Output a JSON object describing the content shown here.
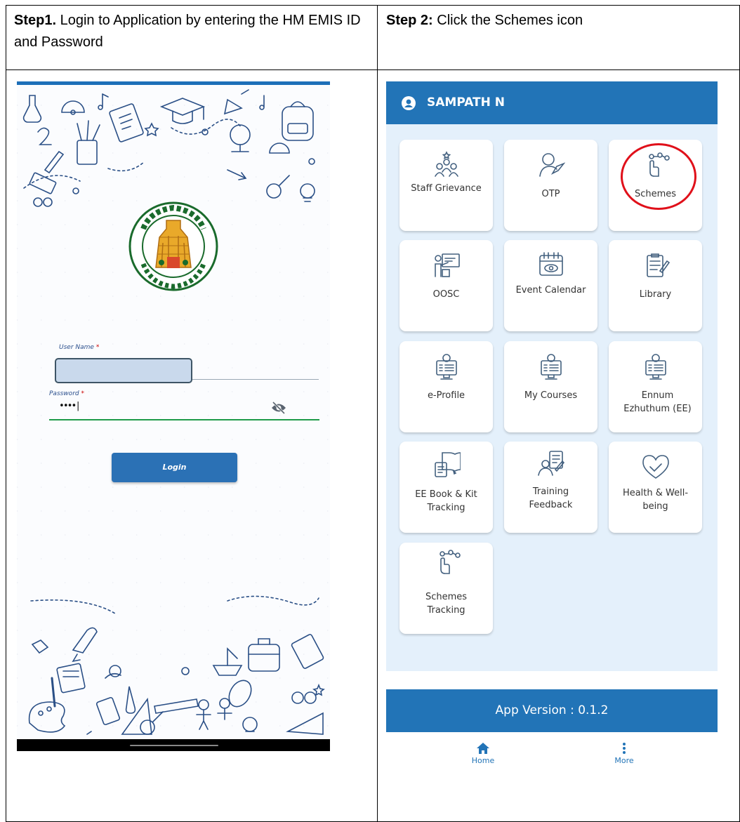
{
  "steps": {
    "step1": {
      "bold": "Step1.",
      "text": " Login to Application by entering the HM EMIS ID and Password"
    },
    "step2": {
      "bold": "Step 2:",
      "text": " Click the Schemes icon"
    }
  },
  "login_screen": {
    "username_label": "User Name",
    "password_label": "Password",
    "required_mark": "*",
    "username_value": "",
    "password_value": "••••|",
    "login_button": "Login",
    "emblem_text": "வாய்மையே வெல்லும்"
  },
  "app_screen": {
    "user_name": "SAMPATH N",
    "tiles": [
      {
        "label": "Staff Grievance",
        "icon": "staff-grievance-icon"
      },
      {
        "label": "OTP",
        "icon": "otp-icon"
      },
      {
        "label": "Schemes",
        "icon": "schemes-icon"
      },
      {
        "label": "OOSC",
        "icon": "oosc-icon"
      },
      {
        "label": "Event Calendar",
        "icon": "event-calendar-icon"
      },
      {
        "label": "Library",
        "icon": "library-icon"
      },
      {
        "label": "e-Profile",
        "icon": "e-profile-icon"
      },
      {
        "label": "My Courses",
        "icon": "my-courses-icon"
      },
      {
        "label": "Ennum Ezhuthum (EE)",
        "icon": "ennum-ezhuthum-icon"
      },
      {
        "label": "EE Book & Kit Tracking",
        "icon": "ee-book-kit-icon"
      },
      {
        "label": "Training Feedback",
        "icon": "training-feedback-icon"
      },
      {
        "label": "Health & Well-being",
        "icon": "health-wellbeing-icon"
      },
      {
        "label": "Schemes Tracking",
        "icon": "schemes-tracking-icon"
      }
    ],
    "app_version": "App Version : 0.1.2",
    "nav": {
      "home": "Home",
      "more": "More"
    },
    "colors": {
      "primary": "#2274b7",
      "background": "#e4f0fb",
      "highlight": "#e0101a"
    }
  }
}
